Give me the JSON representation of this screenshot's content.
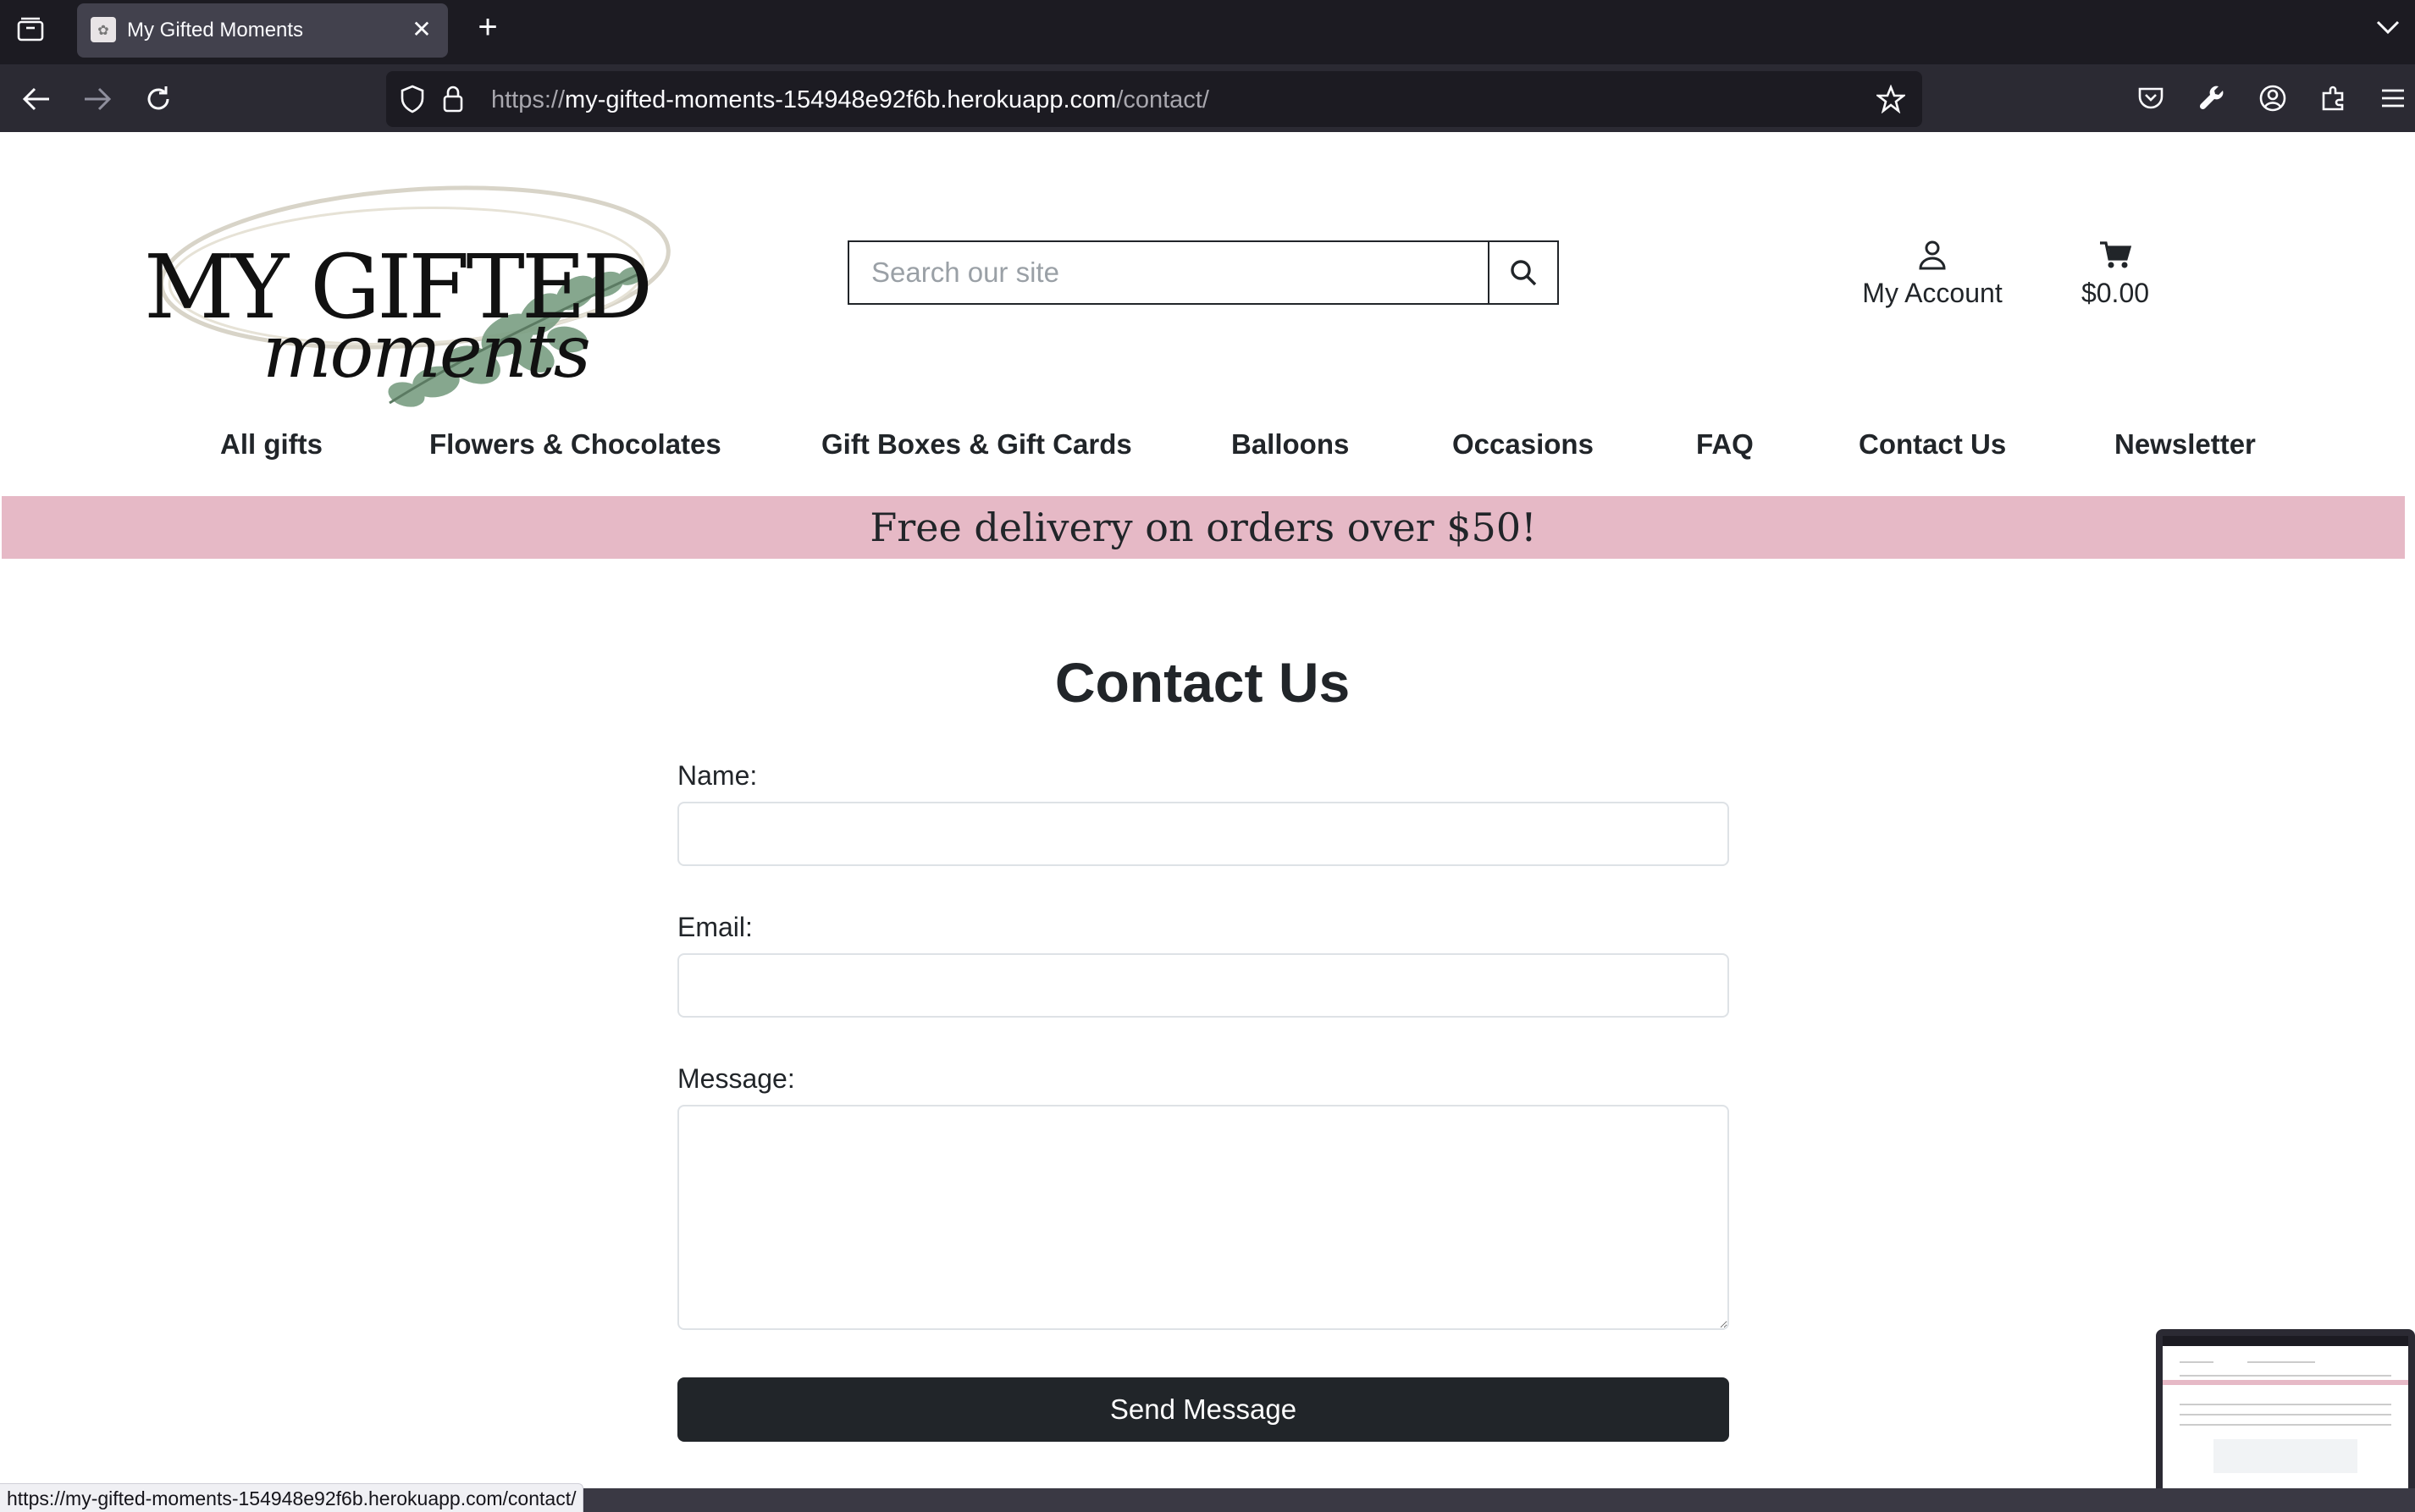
{
  "browser": {
    "tab_title": "My Gifted Moments",
    "url_prefix": "https://",
    "url_host": "my-gifted-moments-154948e92f6b.herokuapp.com",
    "url_path": "/contact/",
    "status_url": "https://my-gifted-moments-154948e92f6b.herokuapp.com/contact/"
  },
  "header": {
    "logo_title": "MY GIFTED",
    "logo_script": "moments",
    "search_placeholder": "Search our site",
    "account_label": "My Account",
    "cart_total": "$0.00"
  },
  "nav": {
    "items": [
      "All gifts",
      "Flowers & Chocolates",
      "Gift Boxes & Gift Cards",
      "Balloons",
      "Occasions",
      "FAQ",
      "Contact Us",
      "Newsletter"
    ]
  },
  "promo": {
    "text": "Free delivery on orders over $50!",
    "color": "#e6b9c6"
  },
  "contact": {
    "title": "Contact Us",
    "name_label": "Name:",
    "name_value": "",
    "email_label": "Email:",
    "email_value": "",
    "message_label": "Message:",
    "message_value": "",
    "submit_label": "Send Message"
  },
  "colors": {
    "accent": "#212529",
    "chrome_dark": "#1c1b22",
    "chrome_bar": "#2b2a33"
  }
}
